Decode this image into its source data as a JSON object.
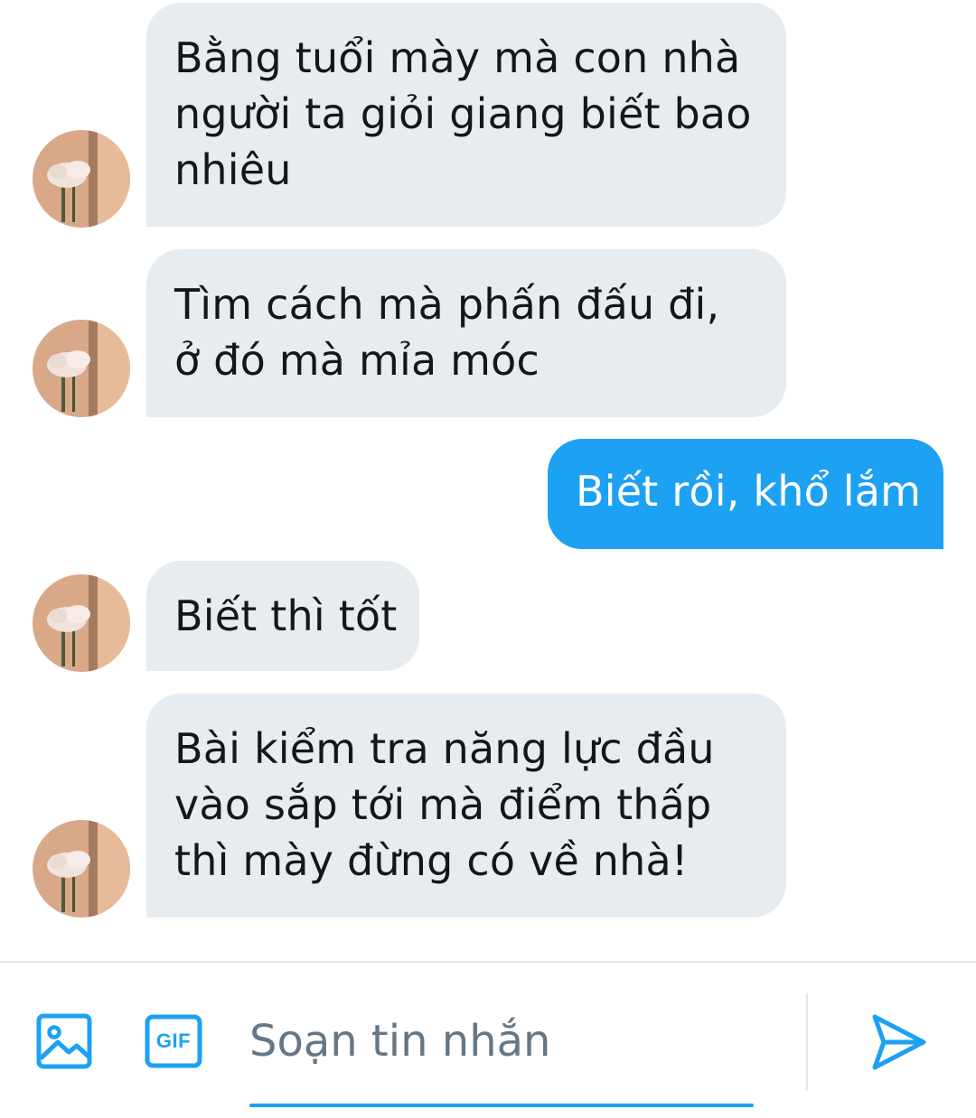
{
  "conversation": {
    "messages": [
      {
        "direction": "incoming",
        "lines": [
          "Bằng tuổi mày mà con nhà",
          "người ta giỏi giang biết bao",
          "nhiêu"
        ]
      },
      {
        "direction": "incoming",
        "lines": [
          "Tìm cách mà phấn đấu đi,",
          "ở đó mà mỉa móc"
        ]
      },
      {
        "direction": "outgoing",
        "lines": [
          "Biết rồi, khổ lắm"
        ]
      },
      {
        "direction": "incoming",
        "lines": [
          "Biết thì tốt"
        ]
      },
      {
        "direction": "incoming",
        "lines": [
          "Bài kiểm tra năng lực đầu",
          "vào sắp tới mà điểm thấp",
          "thì mày đừng có về nhà!"
        ]
      }
    ]
  },
  "composer": {
    "placeholder": "Soạn tin nhắn",
    "gif_label": "GIF",
    "icons": {
      "media": "image-icon",
      "gif": "gif-icon",
      "send": "send-icon"
    }
  },
  "colors": {
    "accent": "#1da1f2",
    "incoming_bubble": "#e7ecf0",
    "incoming_text": "#14171a",
    "outgoing_text": "#ffffff",
    "placeholder": "#657786"
  }
}
